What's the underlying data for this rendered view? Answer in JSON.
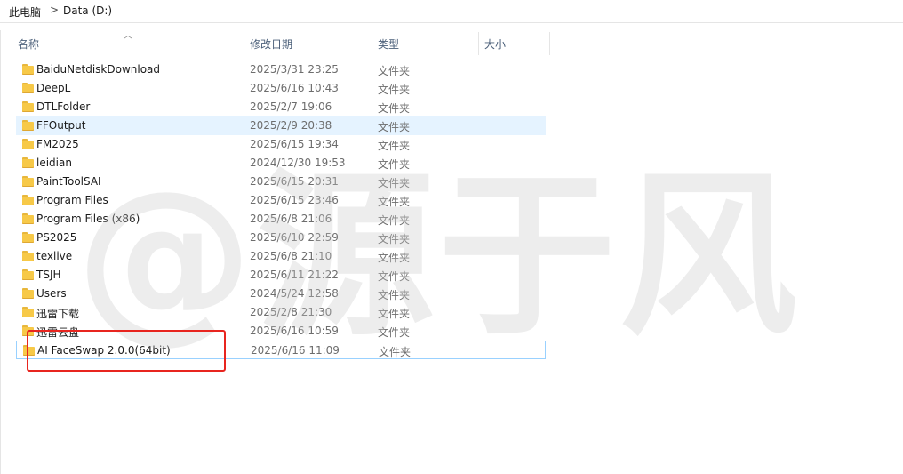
{
  "breadcrumb": {
    "root": "此电脑",
    "separator": ">",
    "current": "Data (D:)"
  },
  "columns": {
    "name": "名称",
    "date": "修改日期",
    "type": "类型",
    "size": "大小",
    "sort_icon": "chevron-up"
  },
  "rows": [
    {
      "name": "BaiduNetdiskDownload",
      "date": "2025/3/31 23:25",
      "type": "文件夹"
    },
    {
      "name": "DeepL",
      "date": "2025/6/16 10:43",
      "type": "文件夹"
    },
    {
      "name": "DTLFolder",
      "date": "2025/2/7 19:06",
      "type": "文件夹"
    },
    {
      "name": "FFOutput",
      "date": "2025/2/9 20:38",
      "type": "文件夹",
      "state": "hover"
    },
    {
      "name": "FM2025",
      "date": "2025/6/15 19:34",
      "type": "文件夹"
    },
    {
      "name": "leidian",
      "date": "2024/12/30 19:53",
      "type": "文件夹"
    },
    {
      "name": "PaintToolSAI",
      "date": "2025/6/15 20:31",
      "type": "文件夹"
    },
    {
      "name": "Program Files",
      "date": "2025/6/15 23:46",
      "type": "文件夹"
    },
    {
      "name": "Program Files (x86)",
      "date": "2025/6/8 21:06",
      "type": "文件夹"
    },
    {
      "name": "PS2025",
      "date": "2025/6/10 22:59",
      "type": "文件夹"
    },
    {
      "name": "texlive",
      "date": "2025/6/8 21:10",
      "type": "文件夹"
    },
    {
      "name": "TSJH",
      "date": "2025/6/11 21:22",
      "type": "文件夹"
    },
    {
      "name": "Users",
      "date": "2024/5/24 12:58",
      "type": "文件夹"
    },
    {
      "name": "迅雷下载",
      "date": "2025/2/8 21:30",
      "type": "文件夹"
    },
    {
      "name": "迅雷云盘",
      "date": "2025/6/16 10:59",
      "type": "文件夹"
    },
    {
      "name": "AI FaceSwap 2.0.0(64bit)",
      "date": "2025/6/16 11:09",
      "type": "文件夹",
      "state": "selected"
    }
  ],
  "watermark": "@源于风",
  "colors": {
    "hover": "#e5f3ff",
    "selected_border": "#99d1ff",
    "highlight": "#e8251f",
    "folder": "#f7c948"
  }
}
